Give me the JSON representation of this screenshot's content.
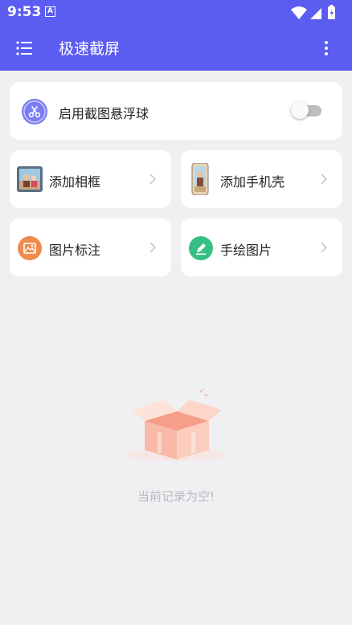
{
  "status": {
    "time": "9:53",
    "badge": "A"
  },
  "appbar": {
    "title": "极速截屏"
  },
  "float_toggle": {
    "label": "启用截图悬浮球",
    "enabled": false
  },
  "tiles": [
    {
      "label": "添加相框"
    },
    {
      "label": "添加手机壳"
    },
    {
      "label": "图片标注"
    },
    {
      "label": "手绘图片"
    }
  ],
  "empty_state": {
    "text": "当前记录为空!"
  },
  "colors": {
    "accent": "#5b5cf0",
    "annotate": "#f28a4e",
    "draw": "#36bf83"
  }
}
